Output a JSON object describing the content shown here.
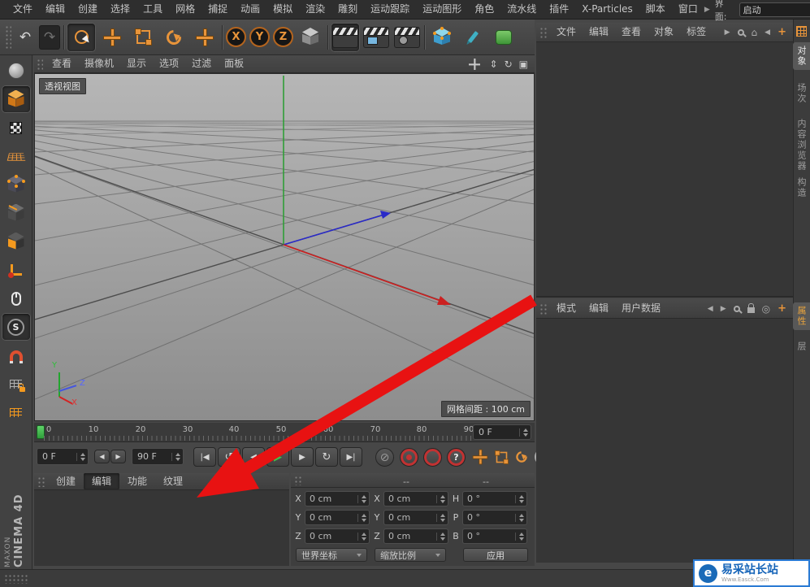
{
  "colors": {
    "accent_orange": "#e8943a",
    "play_green": "#3ec24a",
    "record_red": "#c23232",
    "arrow_red": "#e81212",
    "brand_blue": "#1a6ab8",
    "viewport_top": "#b6b6b6",
    "viewport_bottom": "#8d8d8d"
  },
  "menubar": {
    "items": [
      "文件",
      "编辑",
      "创建",
      "选择",
      "工具",
      "网格",
      "捕捉",
      "动画",
      "模拟",
      "渲染",
      "雕刻",
      "运动跟踪",
      "运动图形",
      "角色",
      "流水线",
      "插件",
      "X-Particles",
      "脚本",
      "窗口"
    ],
    "more_arrow": "▶",
    "interface_label": "界面:",
    "interface_value": "启动"
  },
  "toolbar": {
    "undo_glyph": "↶",
    "redo_glyph": "↷",
    "axis_locks": [
      "X",
      "Y",
      "Z"
    ]
  },
  "left_toolbar": {
    "snap_letter": "S",
    "brand_line1": "MAXON",
    "brand_line2": "CINEMA 4D"
  },
  "viewport": {
    "menus": [
      "查看",
      "摄像机",
      "显示",
      "选项",
      "过滤",
      "面板"
    ],
    "view_label": "透视视图",
    "grid_spacing": "网格间距 : 100 cm",
    "nav_zoom": "⇕",
    "nav_rotate": "↻",
    "nav_toggle": "▣",
    "gizmo": {
      "x": "X",
      "y": "Y",
      "z": "Z"
    }
  },
  "timeline": {
    "ticks": [
      "0",
      "10",
      "20",
      "30",
      "40",
      "50",
      "60",
      "70",
      "80",
      "90"
    ],
    "frame_field": "0 F"
  },
  "transport": {
    "current_frame": "0 F",
    "end_frame": "90 F",
    "prev_key": "◀",
    "next_key": "▶",
    "goto_start": "|◀",
    "play_back": "↺",
    "prev_frame": "◀",
    "play": "▶",
    "next_frame": "▶",
    "loop": "↻",
    "goto_end": "▶|",
    "no_entry": "⊘",
    "help": "?",
    "param_toggle": "P"
  },
  "materials": {
    "tabs": [
      "创建",
      "编辑",
      "功能",
      "纹理"
    ]
  },
  "coords": {
    "headers": [
      "--",
      "--"
    ],
    "position": [
      {
        "label": "X",
        "value": "0 cm"
      },
      {
        "label": "Y",
        "value": "0 cm"
      },
      {
        "label": "Z",
        "value": "0 cm"
      }
    ],
    "size": [
      {
        "label": "X",
        "value": "0 cm"
      },
      {
        "label": "Y",
        "value": "0 cm"
      },
      {
        "label": "Z",
        "value": "0 cm"
      }
    ],
    "rotation": [
      {
        "label": "H",
        "value": "0 °"
      },
      {
        "label": "P",
        "value": "0 °"
      },
      {
        "label": "B",
        "value": "0 °"
      }
    ],
    "coord_system": "世界坐标",
    "scale_mode": "缩放比例",
    "apply_label": "应用"
  },
  "object_manager": {
    "menus": [
      "文件",
      "编辑",
      "查看",
      "对象",
      "标签"
    ],
    "more_arrow": "▶",
    "home_glyph": "⌂",
    "back_glyph": "◀",
    "add_glyph": "+"
  },
  "attribute_manager": {
    "menus": [
      "模式",
      "编辑",
      "用户数据"
    ],
    "nav_left": "◀",
    "nav_right": "▶",
    "target_glyph": "◎",
    "add_glyph": "+"
  },
  "right_tabs": {
    "top": [
      "对象",
      "场次",
      "内容浏览器",
      "构造"
    ],
    "bottom": [
      "属性",
      "层"
    ]
  },
  "watermark": {
    "title": "易采站长站",
    "subtitle": "Www.Easck.Com"
  }
}
